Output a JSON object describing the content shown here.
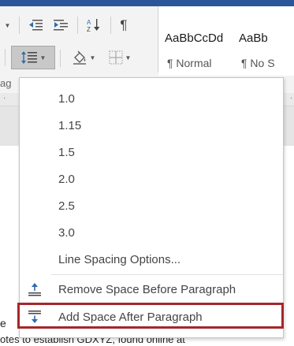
{
  "ribbon": {
    "paragraph_mark_label": "¶",
    "group_label": "ag",
    "styles": [
      {
        "sample": "AaBbCcDd",
        "name": "¶ Normal"
      },
      {
        "sample": "AaBb",
        "name": "¶ No S"
      }
    ]
  },
  "ruler": {
    "tick_left": "·",
    "tick_right": "·"
  },
  "line_spacing_menu": {
    "options": [
      "1.0",
      "1.15",
      "1.5",
      "2.0",
      "2.5",
      "3.0"
    ],
    "line_spacing_options": "Line Spacing Options...",
    "remove_space_before": "Remove Space Before Paragraph",
    "add_space_after": "Add Space After Paragraph"
  },
  "document": {
    "line_fragment_1": "e",
    "line_fragment_2": "otes to establish GDXYZ, found online at"
  },
  "colors": {
    "accent": "#2b579a",
    "highlight_border": "#a5272a",
    "icon_blue": "#2b6cb0"
  }
}
